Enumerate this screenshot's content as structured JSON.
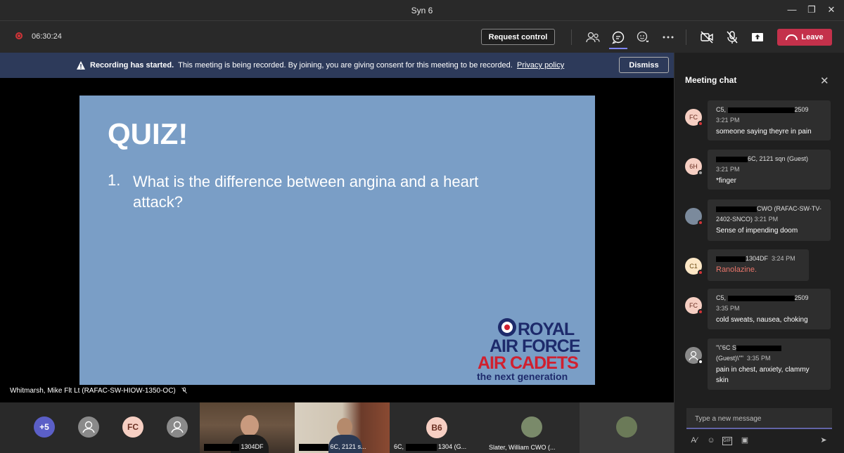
{
  "window": {
    "title": "Syn 6"
  },
  "toolbar": {
    "timer": "06:30:24",
    "request_control": "Request control",
    "leave": "Leave"
  },
  "banner": {
    "bold": "Recording has started.",
    "text": "This meeting is being recorded. By joining, you are giving consent for this meeting to be recorded.",
    "link": "Privacy policy",
    "dismiss": "Dismiss"
  },
  "slide": {
    "title": "QUIZ!",
    "number": "1.",
    "question": "What is the difference between angina and a heart attack?",
    "logo": {
      "line1": "ROYAL",
      "line2": "AIR FORCE",
      "line3": "AIR CADETS",
      "line4": "the next generation"
    }
  },
  "presenter": {
    "name": "Whitmarsh, Mike Flt Lt (RAFAC-SW-HIOW-1350-OC)"
  },
  "gallery": {
    "overflow": "+5",
    "fc_initials": "FC",
    "b6_initials": "B6",
    "tile1_caption": "1304DF",
    "tile2_caption": "6C, 2121 s...",
    "tile3_caption_prefix": "6C,",
    "tile3_caption_suffix": "1304 (G...",
    "tile4_caption": "Slater, William CWO (..."
  },
  "chat": {
    "title": "Meeting chat",
    "composer_placeholder": "Type a new message",
    "messages": [
      {
        "initials": "FC",
        "name_prefix": "C5,",
        "name_suffix": "2509",
        "time": "3:21 PM",
        "text": "someone saying theyre in pain"
      },
      {
        "initials": "6H",
        "name_suffix": "6C, 2121 sqn (Guest)",
        "time": "3:21 PM",
        "text": "*finger"
      },
      {
        "initials": "",
        "name_suffix": "CWO (RAFAC-SW-TV-2402-SNCO)",
        "time": "3:21 PM",
        "text": "Sense of impending doom"
      },
      {
        "initials": "C1",
        "name_suffix": "1304DF",
        "time": "3:24 PM",
        "text": "Ranolazine."
      },
      {
        "initials": "FC",
        "name_prefix": "C5,",
        "name_suffix": "2509",
        "time": "3:35 PM",
        "text": "cold sweats, nausea, choking"
      },
      {
        "initials": "",
        "name_prefix": "\"\\\"6C S",
        "name_suffix": "(Guest)\\\"\"",
        "time": "3:35 PM",
        "text": "pain in chest, anxiety, clammy skin"
      }
    ]
  },
  "colors": {
    "leave": "#c4314b",
    "banner": "#2d3a5a",
    "slide": "#7a9ec6",
    "accent": "#6264a7",
    "raf_blue": "#1d2a6b",
    "raf_red": "#d0202f"
  }
}
